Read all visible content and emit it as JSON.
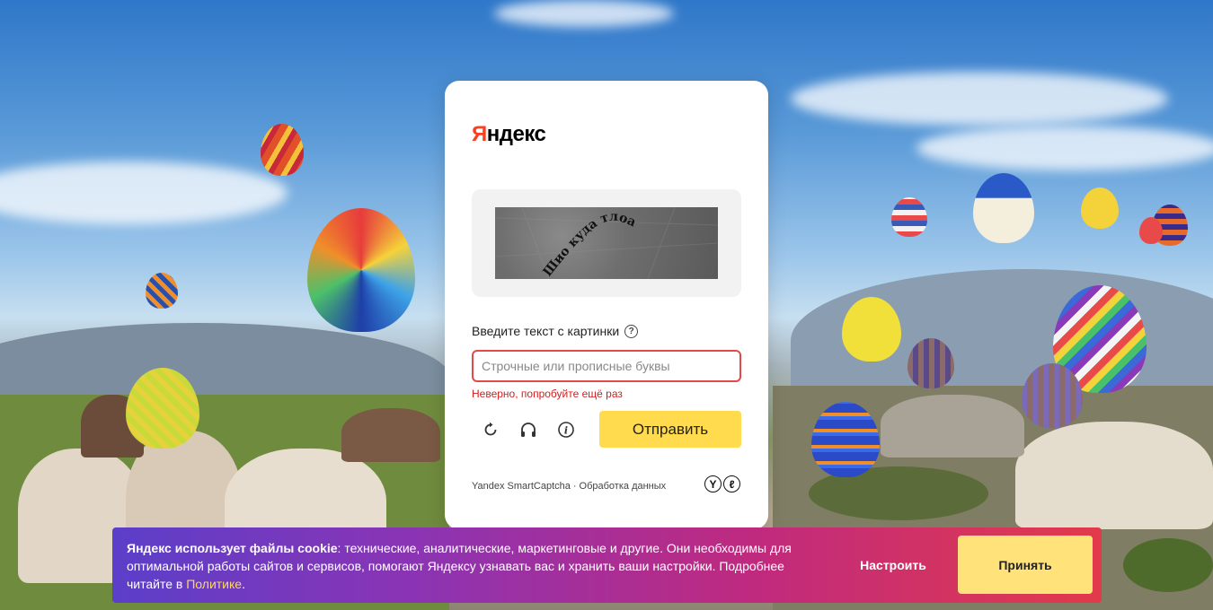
{
  "background": {
    "description_icon": "hot-air-balloons-landscape"
  },
  "captcha": {
    "logo_first": "Я",
    "logo_rest": "ндекс",
    "image_text": "Шио куда тлоа",
    "prompt": "Введите текст с картинки",
    "input_placeholder": "Строчные или прописные буквы",
    "input_value": "",
    "error": "Неверно, попробуйте ещё раз",
    "submit_label": "Отправить",
    "tools": [
      "refresh-icon",
      "audio-icon",
      "info-icon"
    ],
    "footer_brand": "Yandex SmartCaptcha",
    "footer_separator": "·",
    "footer_link": "Обработка данных",
    "accent_color": "#ffdb4d",
    "error_color": "#e24a4a"
  },
  "cookie": {
    "bold_text": "Яндекс использует файлы cookie",
    "text": ": технические, аналитические, маркетинговые и другие. Они необходимы для оптимальной работы сайтов и сервисов, помогают Яндексу узнавать вас и хранить ваши настройки. Подробнее читайте в ",
    "link": "Политике",
    "tail": ".",
    "configure_label": "Настроить",
    "accept_label": "Принять"
  }
}
